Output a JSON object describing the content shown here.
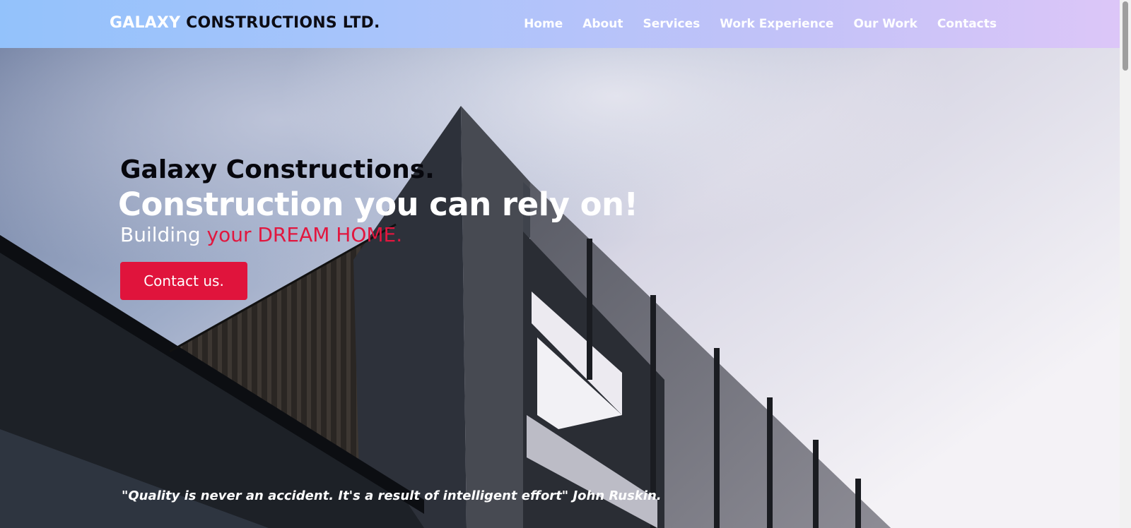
{
  "navbar": {
    "brand_part1": "GALAXY",
    "brand_part2": "CONSTRUCTIONS LTD.",
    "links": [
      "Home",
      "About",
      "Services",
      "Work Experience",
      "Our Work",
      "Contacts"
    ]
  },
  "hero": {
    "title": "Galaxy Constructions.",
    "tagline": "Construction you can rely on!",
    "subtitle_lead": "Building ",
    "subtitle_accent": "your DREAM HOME.",
    "cta_label": "Contact us.",
    "quote": "\"Quality is never an accident. It's a result of intelligent effort\" John Ruskin."
  },
  "colors": {
    "accent": "#e0143c",
    "nav_gradient_start": "#93c2fb",
    "nav_gradient_end": "#dcc6f8"
  }
}
